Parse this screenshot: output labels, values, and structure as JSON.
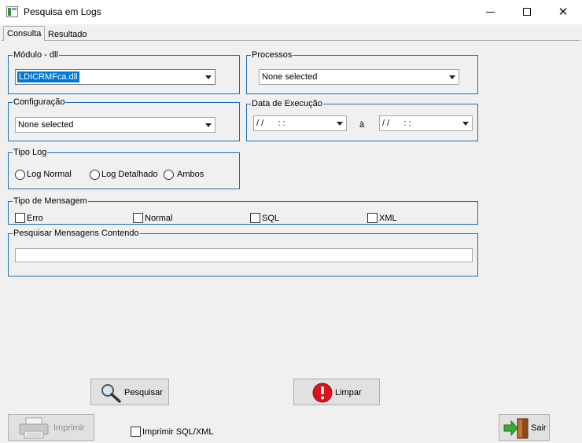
{
  "window": {
    "title": "Pesquisa em Logs"
  },
  "tabs": [
    {
      "label": "Consulta"
    },
    {
      "label": "Resultado"
    }
  ],
  "modulo": {
    "label": "Módulo - dll",
    "value": "LDICRMFca.dll"
  },
  "processos": {
    "label": "Processos",
    "value": "None selected"
  },
  "configuracao": {
    "label": "Configuração",
    "value": "None selected"
  },
  "data_execucao": {
    "label": "Data de Execução",
    "start": "/ /      : :",
    "separator": "à",
    "end": "/ /      : :"
  },
  "tipo_log": {
    "label": "Tipo Log",
    "options": [
      "Log Normal",
      "Log Detalhado",
      "Ambos"
    ]
  },
  "tipo_mensagem": {
    "label": "Tipo de Mensagem",
    "options": [
      "Erro",
      "Normal",
      "SQL",
      "XML"
    ]
  },
  "pesquisar_mensagens": {
    "label": "Pesquisar Mensagens Contendo",
    "value": ""
  },
  "buttons": {
    "pesquisar": "Pesquisar",
    "limpar": "Limpar",
    "imprimir": "Imprimir",
    "sair": "Sair"
  },
  "imprimir_sql": {
    "label": "Imprimir SQL/XML"
  },
  "colors": {
    "group_border": "#1f6fb4",
    "selection": "#0078d7",
    "danger": "#d9141c",
    "exit_green": "#3aa935"
  }
}
